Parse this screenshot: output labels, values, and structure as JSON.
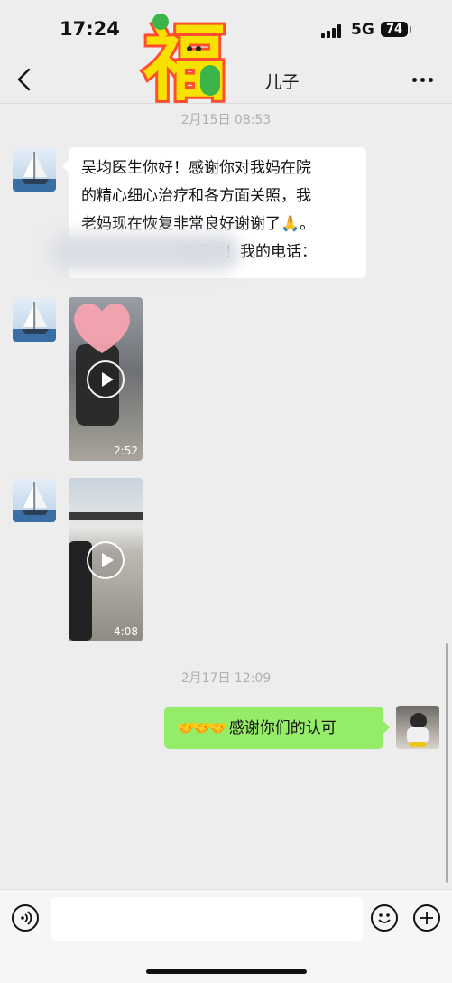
{
  "status_bar": {
    "time": "17:24",
    "network": "5G",
    "battery": "74"
  },
  "nav": {
    "title_suffix": "儿子",
    "sticker": "福"
  },
  "messages": {
    "ts1": "2月15日 08:53",
    "text1": "吴均医生你好！感谢你对我妈在院的精心细心治疗和各方面关照，我老妈现在恢复非常良好谢谢了🙏。",
    "text1_line1": "吴均医生你好！感谢你对我妈在院",
    "text1_line2": "的精心细心治疗和各方面关照，我",
    "text1_line3": "老妈现在恢复非常良好谢谢了",
    "text1_line4_visible": "欢迎你！我的电话：",
    "video1_duration": "2:52",
    "video2_duration": "4:08",
    "ts2": "2月17日 12:09",
    "reply_emojis": "🤝🤝🤝",
    "reply_text": "感谢你们的认可"
  },
  "icons": {
    "back": "back-arrow-icon",
    "more": "more-dots-icon",
    "voice": "voice-icon",
    "emoji": "emoji-icon",
    "plus": "plus-icon",
    "play": "play-icon",
    "praying_hands": "praying-hands-emoji",
    "handshake": "handshake-emoji"
  },
  "colors": {
    "chat_bg": "#ededed",
    "sent_bubble": "#95ec69",
    "received_bubble": "#ffffff",
    "timestamp": "#b0b0b0"
  }
}
